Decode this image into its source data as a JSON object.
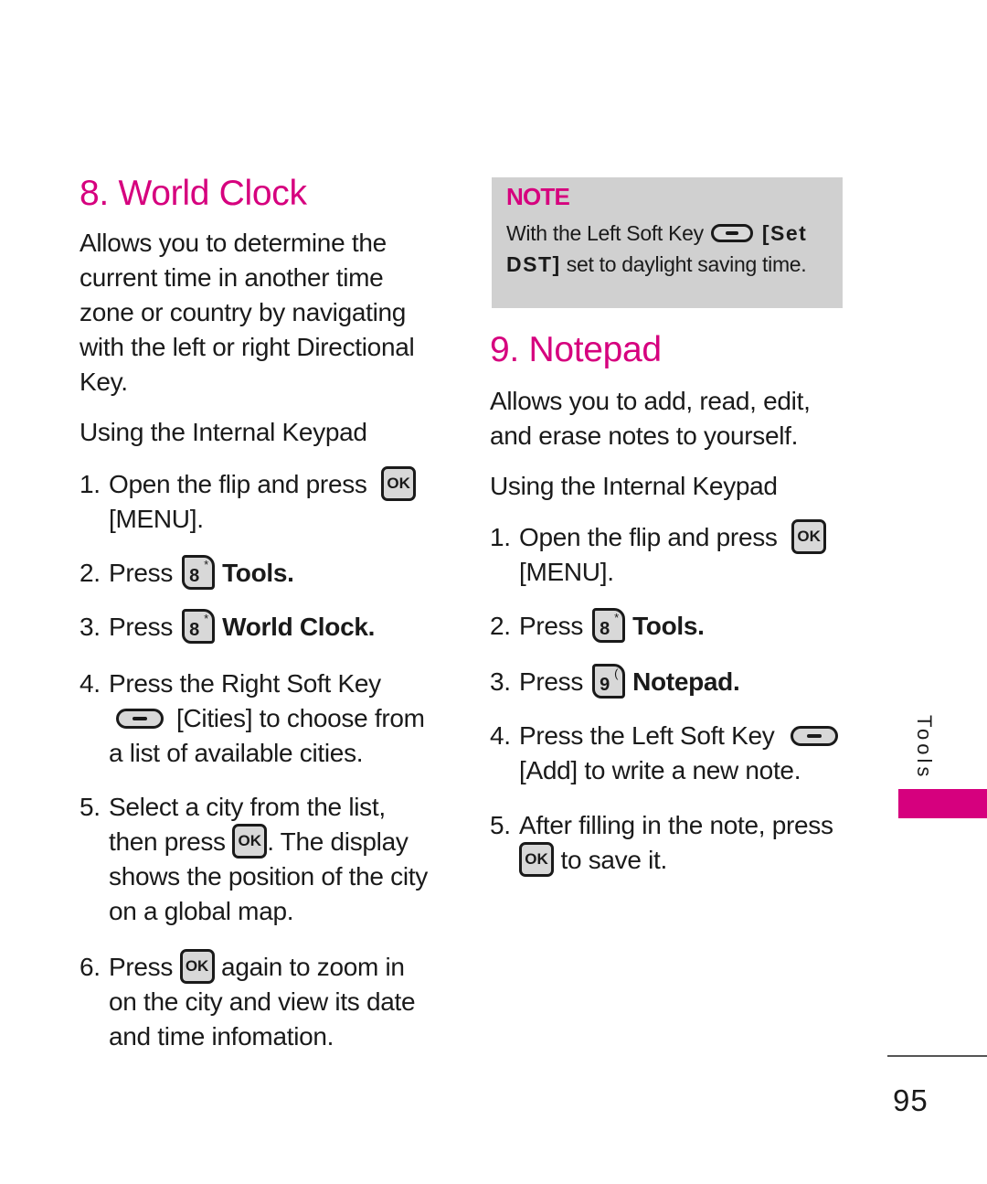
{
  "accent_color": "#d6007e",
  "left": {
    "title": "8. World Clock",
    "description": "Allows you to determine the current time in another time zone or country by navigating with the left or right Directional Key.",
    "desc_lines": [
      "Allows you to determine the",
      "current time in another time",
      "zone or country by navigating",
      "with the left or right Directional",
      "Key."
    ],
    "subhead": "Using the Internal Keypad",
    "steps": [
      {
        "num": "1.",
        "pre": "Open the flip and press",
        "key": "OK",
        "post": "[MENU]."
      },
      {
        "num": "2.",
        "pre": "Press",
        "key": "8",
        "key_sup": "*",
        "bold": "Tools."
      },
      {
        "num": "3.",
        "pre": "Press",
        "key": "8",
        "key_sup": "*",
        "bold": "World Clock."
      },
      {
        "num": "4.",
        "line1": "Press the Right Soft Key",
        "key_icon": "soft-key-icon",
        "bold": "[Cities]",
        "line2_post": " to choose from",
        "line3": "a list of available cities."
      },
      {
        "num": "5.",
        "line1": "Select a city from the list,",
        "line2_pre": "then press",
        "key": "OK",
        "line2_post": ". The display",
        "line3": "shows the position of the city",
        "line4": "on a global map."
      },
      {
        "num": "6.",
        "pre": "Press",
        "key": "OK",
        "post": "again to zoom in",
        "line2": "on the city and view its date",
        "line3": "and time infomation."
      }
    ]
  },
  "note": {
    "title": "NOTE",
    "pre": "With the Left Soft Key",
    "bold1": "[Set",
    "bold2": "DST]",
    "post": " set to daylight saving time."
  },
  "right": {
    "title": "9. Notepad",
    "desc_lines": [
      "Allows you to add, read, edit,",
      "and erase notes to yourself."
    ],
    "subhead": "Using the Internal Keypad",
    "steps": [
      {
        "num": "1.",
        "pre": "Open the flip and press",
        "key": "OK",
        "post": "[MENU]."
      },
      {
        "num": "2.",
        "pre": "Press",
        "key": "8",
        "key_sup": "*",
        "bold": "Tools."
      },
      {
        "num": "3.",
        "pre": "Press",
        "key": "9",
        "key_sup": "(",
        "bold": "Notepad."
      },
      {
        "num": "4.",
        "line1": "Press the Left Soft Key",
        "bold": "[Add]",
        "line2_post": " to write a new note."
      },
      {
        "num": "5.",
        "line1": "After filling in the note, press",
        "key": "OK",
        "line2_post": " to save it."
      }
    ]
  },
  "side_tab": {
    "label": "Tools"
  },
  "page_number": "95"
}
